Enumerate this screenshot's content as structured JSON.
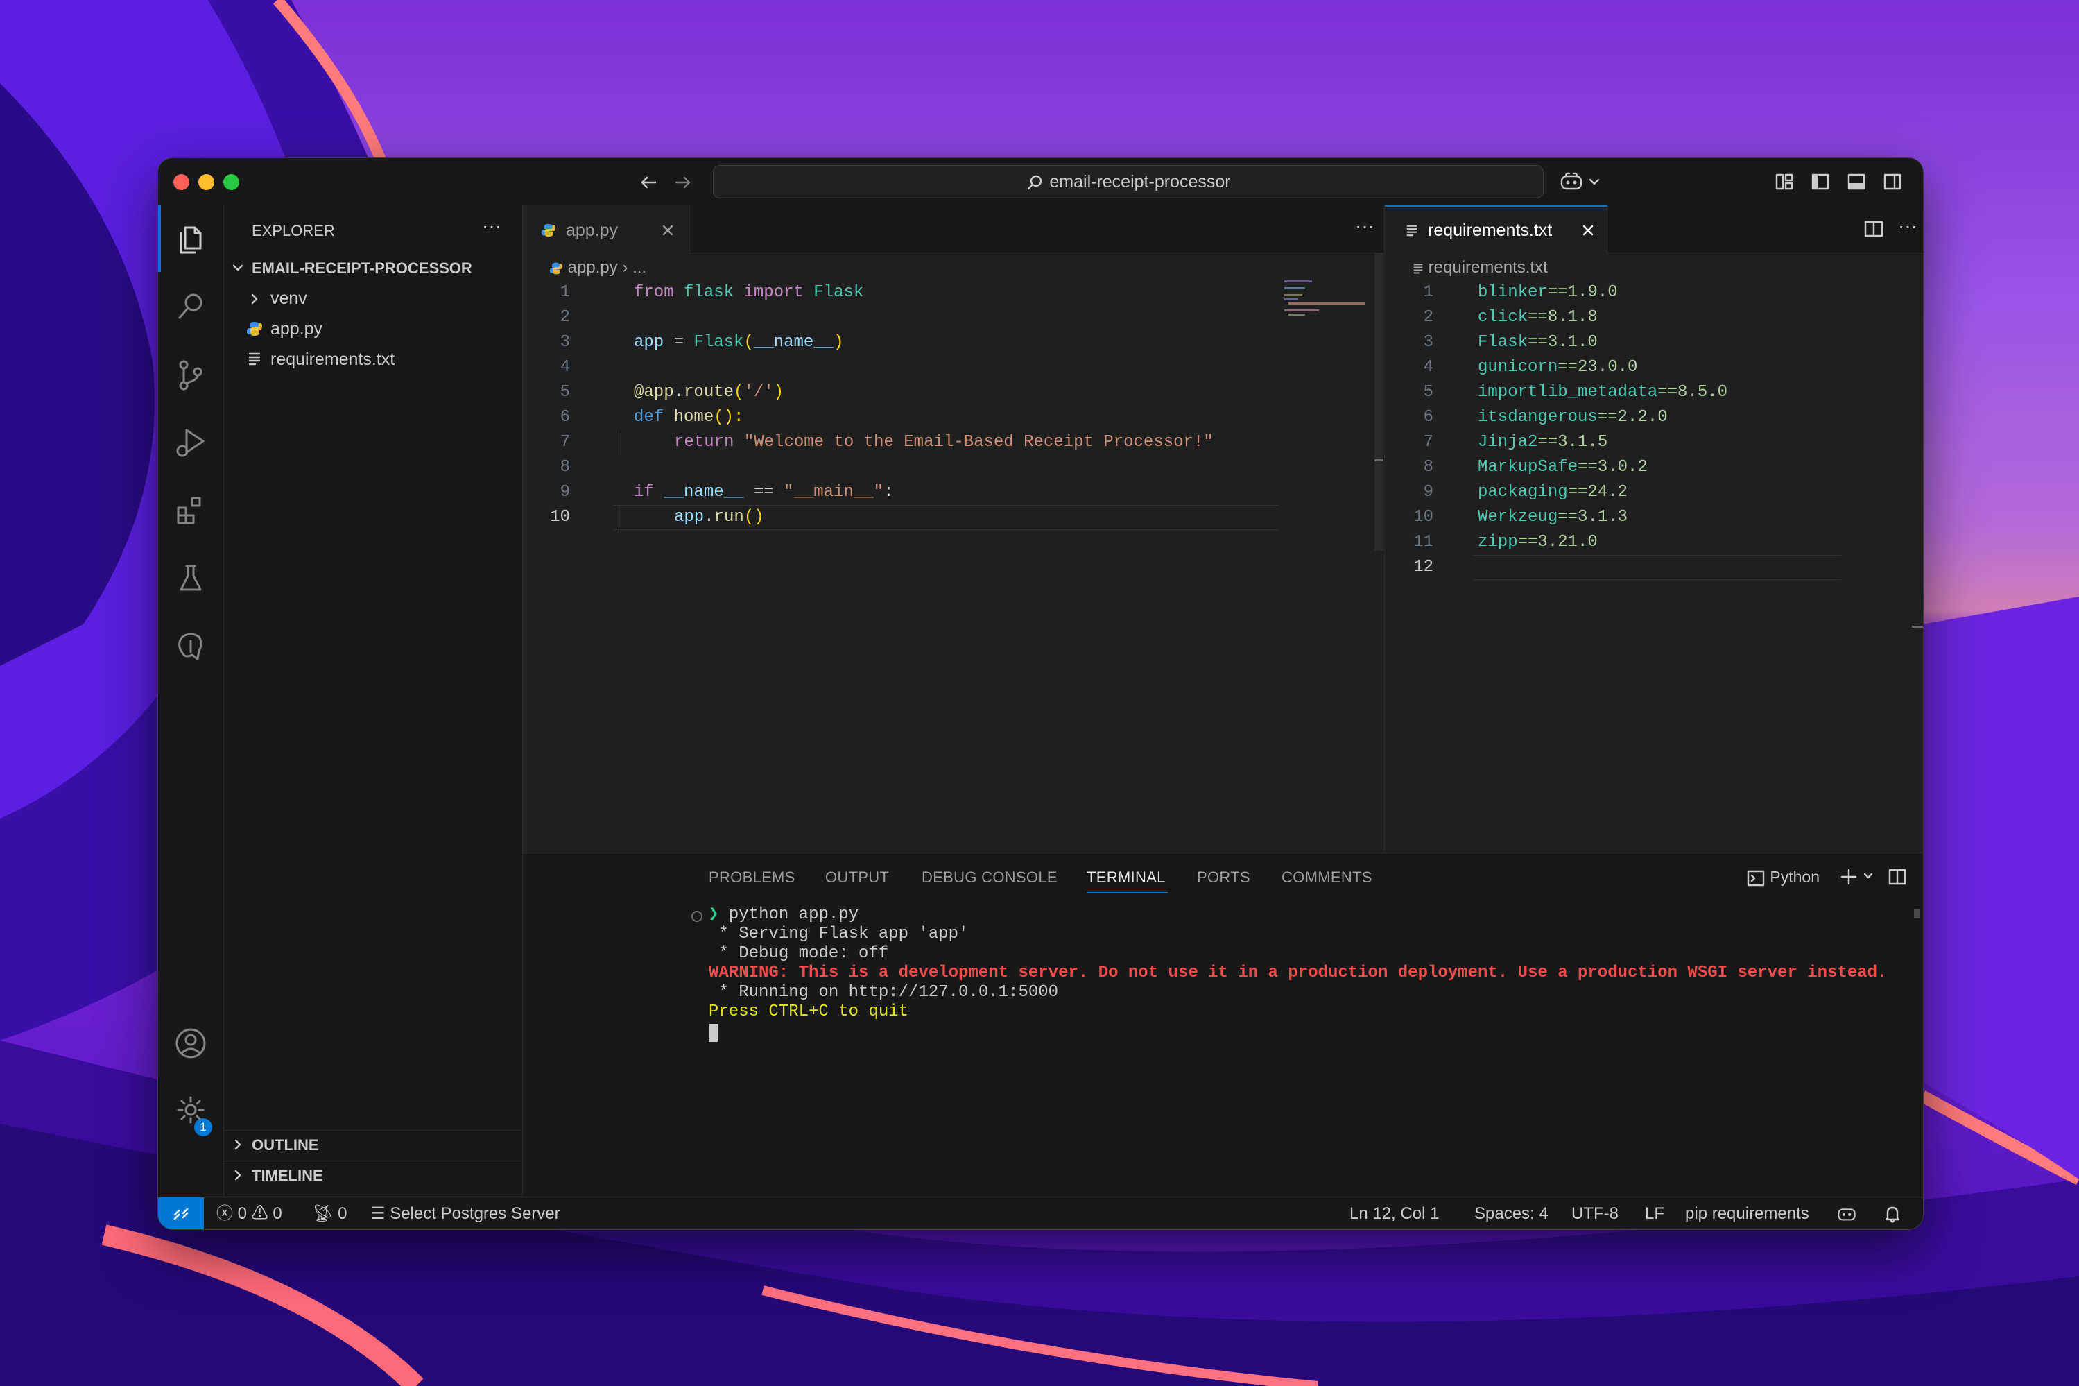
{
  "window": {
    "search_text": "email-receipt-processor"
  },
  "colors": {
    "accent": "#0078d4",
    "keyword": "#c586c0",
    "blue_keyword": "#569cd6",
    "string": "#ce9178",
    "function": "#dcdcaa",
    "class": "#4ec9b0",
    "variable": "#9cdcfe",
    "error": "#f14c4c",
    "warning_yellow": "#e5e510"
  },
  "sidebar": {
    "title": "EXPLORER",
    "project": "EMAIL-RECEIPT-PROCESSOR",
    "items": [
      {
        "label": "venv",
        "icon": "chevron-right-icon"
      },
      {
        "label": "app.py",
        "icon": "python-icon"
      },
      {
        "label": "requirements.txt",
        "icon": "text-file-icon"
      }
    ],
    "outline": "OUTLINE",
    "timeline": "TIMELINE",
    "settings_badge": "1"
  },
  "editor_left": {
    "tab_label": "app.py",
    "breadcrumb_file": "app.py",
    "breadcrumb_more": "...",
    "line_numbers": [
      "1",
      "2",
      "3",
      "4",
      "5",
      "6",
      "7",
      "8",
      "9",
      "10"
    ],
    "active_line": "10"
  },
  "editor_right": {
    "tab_label": "requirements.txt",
    "breadcrumb_file": "requirements.txt",
    "line_numbers": [
      "1",
      "2",
      "3",
      "4",
      "5",
      "6",
      "7",
      "8",
      "9",
      "10",
      "11",
      "12"
    ],
    "active_line": "12",
    "packages": [
      {
        "name": "blinker",
        "ver": "==1.9.0"
      },
      {
        "name": "click",
        "ver": "==8.1.8"
      },
      {
        "name": "Flask",
        "ver": "==3.1.0"
      },
      {
        "name": "gunicorn",
        "ver": "==23.0.0"
      },
      {
        "name": "importlib_metadata",
        "ver": "==8.5.0"
      },
      {
        "name": "itsdangerous",
        "ver": "==2.2.0"
      },
      {
        "name": "Jinja2",
        "ver": "==3.1.5"
      },
      {
        "name": "MarkupSafe",
        "ver": "==3.0.2"
      },
      {
        "name": "packaging",
        "ver": "==24.2"
      },
      {
        "name": "Werkzeug",
        "ver": "==3.1.3"
      },
      {
        "name": "zipp",
        "ver": "==3.21.0"
      }
    ]
  },
  "code": {
    "l1_from": "from",
    "l1_mod": "flask",
    "l1_import": "import",
    "l1_cls": "Flask",
    "l3_app": "app",
    "l3_eq": " = ",
    "l3_cls": "Flask",
    "l3_open": "(",
    "l3_name": "__name__",
    "l3_close": ")",
    "l5_at": "@",
    "l5_app": "app",
    "l5_dot": ".",
    "l5_route": "route",
    "l5_open": "(",
    "l5_str": "'/'",
    "l5_close": ")",
    "l6_def": "def",
    "l6_fn": "home",
    "l6_rest": "():",
    "l7_return": "return",
    "l7_str": "\"Welcome to the Email-Based Receipt Processor!\"",
    "l9_if": "if",
    "l9_name": "__name__",
    "l9_eq": " == ",
    "l9_str": "\"__main__\"",
    "l9_colon": ":",
    "l10_app": "app",
    "l10_dot": ".",
    "l10_run": "run",
    "l10_paren": "()"
  },
  "panel": {
    "tabs": [
      "PROBLEMS",
      "OUTPUT",
      "DEBUG CONSOLE",
      "TERMINAL",
      "PORTS",
      "COMMENTS"
    ],
    "active_tab": "TERMINAL",
    "shell_label": "Python",
    "terminal": {
      "prompt": "❯",
      "command": "python app.py",
      "line1": " * Serving Flask app 'app'",
      "line2": " * Debug mode: off",
      "warning": "WARNING: This is a development server. Do not use it in a production deployment. Use a production WSGI server instead.",
      "line4": " * Running on http://127.0.0.1:5000",
      "quit": "Press CTRL+C to quit"
    }
  },
  "status": {
    "errors": "0",
    "warnings": "0",
    "ports": "0",
    "postgres": "Select Postgres Server",
    "position": "Ln 12, Col 1",
    "spaces": "Spaces: 4",
    "encoding": "UTF-8",
    "eol": "LF",
    "language": "pip requirements"
  }
}
